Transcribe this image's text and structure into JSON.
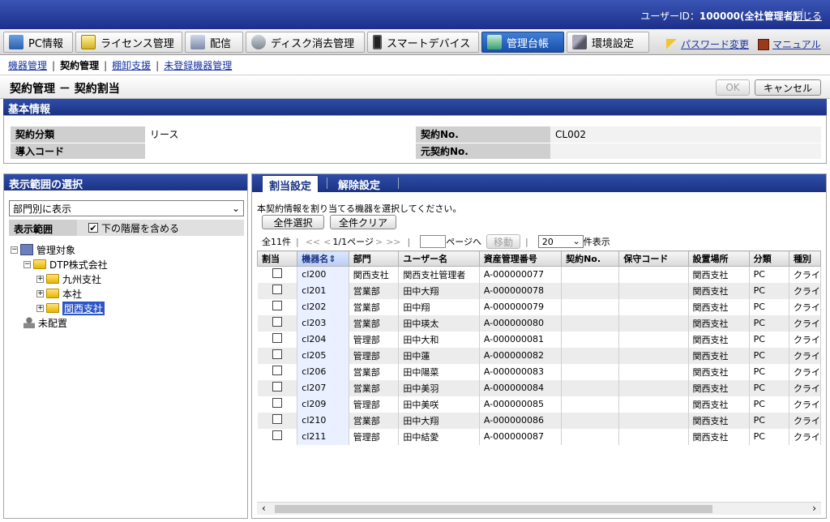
{
  "header": {
    "user_prefix": "ユーザーID：",
    "user_value": "100000(全社管理者)",
    "close_label": "閉じる"
  },
  "menu": {
    "items": [
      {
        "label": "PC情報",
        "icon": "pc-icon"
      },
      {
        "label": "ライセンス管理",
        "icon": "license-icon"
      },
      {
        "label": "配信",
        "icon": "distribution-icon"
      },
      {
        "label": "ディスク消去管理",
        "icon": "disk-erase-icon"
      },
      {
        "label": "スマートデバイス",
        "icon": "smartphone-icon"
      },
      {
        "label": "管理台帳",
        "icon": "ledger-icon"
      },
      {
        "label": "環境設定",
        "icon": "tools-icon"
      }
    ],
    "password_link": "パスワード変更",
    "manual_link": "マニュアル"
  },
  "subnav": {
    "items": [
      "機器管理",
      "契約管理",
      "棚卸支援",
      "未登録機器管理"
    ]
  },
  "page": {
    "title": "契約管理 － 契約割当",
    "ok_label": "OK",
    "cancel_label": "キャンセル"
  },
  "basic_info": {
    "header": "基本情報",
    "rows": [
      {
        "label1": "契約分類",
        "value1": "リース",
        "label2": "契約No.",
        "value2": "CL002"
      },
      {
        "label1": "導入コード",
        "value1": "",
        "label2": "元契約No.",
        "value2": ""
      }
    ]
  },
  "left": {
    "header": "表示範囲の選択",
    "view_select": "部門別に表示",
    "range_label": "表示範囲",
    "include_sub_label": "下の階層を含める",
    "tree": {
      "root": "管理対象",
      "company": "DTP株式会社",
      "branches": [
        "九州支社",
        "本社",
        "関西支社"
      ],
      "unassigned": "未配置"
    }
  },
  "right": {
    "tabs": [
      "割当設定",
      "解除設定"
    ],
    "instruction": "本契約情報を割り当てる機器を選択してください。",
    "select_all": "全件選択",
    "clear_all": "全件クリア",
    "pager": {
      "total": "全11件",
      "first": "<<",
      "prev": "<",
      "page": "1/1ページ",
      "next": ">",
      "last": ">>",
      "page_suffix": "ページへ",
      "move": "移動",
      "per_page": "20",
      "per_page_suffix": "件表示"
    },
    "columns": [
      "割当",
      "機器名",
      "部門",
      "ユーザー名",
      "資産管理番号",
      "契約No.",
      "保守コード",
      "設置場所",
      "分類",
      "種別"
    ],
    "sort_indicator": "⇕",
    "rows": [
      [
        "cl200",
        "関西支社",
        "関西支社管理者",
        "A-000000077",
        "",
        "",
        "関西支社",
        "PC",
        "クライ"
      ],
      [
        "cl201",
        "営業部",
        "田中大翔",
        "A-000000078",
        "",
        "",
        "関西支社",
        "PC",
        "クライ"
      ],
      [
        "cl202",
        "営業部",
        "田中翔",
        "A-000000079",
        "",
        "",
        "関西支社",
        "PC",
        "クライ"
      ],
      [
        "cl203",
        "営業部",
        "田中瑛太",
        "A-000000080",
        "",
        "",
        "関西支社",
        "PC",
        "クライ"
      ],
      [
        "cl204",
        "管理部",
        "田中大和",
        "A-000000081",
        "",
        "",
        "関西支社",
        "PC",
        "クライ"
      ],
      [
        "cl205",
        "管理部",
        "田中蓮",
        "A-000000082",
        "",
        "",
        "関西支社",
        "PC",
        "クライ"
      ],
      [
        "cl206",
        "営業部",
        "田中陽菜",
        "A-000000083",
        "",
        "",
        "関西支社",
        "PC",
        "クライ"
      ],
      [
        "cl207",
        "営業部",
        "田中美羽",
        "A-000000084",
        "",
        "",
        "関西支社",
        "PC",
        "クライ"
      ],
      [
        "cl209",
        "管理部",
        "田中美咲",
        "A-000000085",
        "",
        "",
        "関西支社",
        "PC",
        "クライ"
      ],
      [
        "cl210",
        "営業部",
        "田中大翔",
        "A-000000086",
        "",
        "",
        "関西支社",
        "PC",
        "クライ"
      ],
      [
        "cl211",
        "管理部",
        "田中結愛",
        "A-000000087",
        "",
        "",
        "関西支社",
        "PC",
        "クライ"
      ]
    ]
  },
  "colors": {
    "header_blue": "#1c2f8a",
    "active_menu": "#1a4fa8",
    "link": "#1a33a0"
  }
}
